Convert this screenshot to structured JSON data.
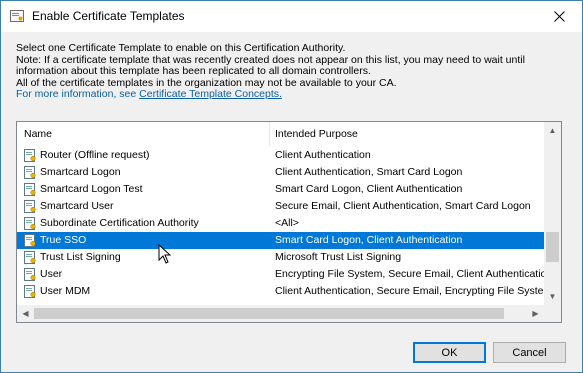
{
  "window": {
    "title": "Enable Certificate Templates"
  },
  "description": {
    "line1": "Select one Certificate Template to enable on this Certification Authority.",
    "line2": "Note: If a certificate template that was recently created does not appear on this list, you may need to wait until",
    "line3": "information about this template has been replicated to all domain controllers.",
    "line4": "All of the certificate templates in the organization may not be available to your CA.",
    "link_prefix": "For more information, see ",
    "link_text": "Certificate Template Concepts."
  },
  "list": {
    "columns": {
      "name": "Name",
      "purpose": "Intended Purpose"
    },
    "rows": [
      {
        "name": "Router (Offline request)",
        "purpose": "Client Authentication",
        "selected": false
      },
      {
        "name": "Smartcard Logon",
        "purpose": "Client Authentication, Smart Card Logon",
        "selected": false
      },
      {
        "name": "Smartcard Logon Test",
        "purpose": "Smart Card Logon, Client Authentication",
        "selected": false
      },
      {
        "name": "Smartcard User",
        "purpose": "Secure Email, Client Authentication, Smart Card Logon",
        "selected": false
      },
      {
        "name": "Subordinate Certification Authority",
        "purpose": "<All>",
        "selected": false
      },
      {
        "name": "True SSO",
        "purpose": "Smart Card Logon, Client Authentication",
        "selected": true
      },
      {
        "name": "Trust List Signing",
        "purpose": "Microsoft Trust List Signing",
        "selected": false
      },
      {
        "name": "User",
        "purpose": "Encrypting File System, Secure Email, Client Authentication",
        "selected": false
      },
      {
        "name": "User MDM",
        "purpose": "Client Authentication, Secure Email, Encrypting File System",
        "selected": false
      }
    ]
  },
  "buttons": {
    "ok": "OK",
    "cancel": "Cancel"
  },
  "colors": {
    "selection": "#0078d7",
    "link": "#0b61a4"
  }
}
